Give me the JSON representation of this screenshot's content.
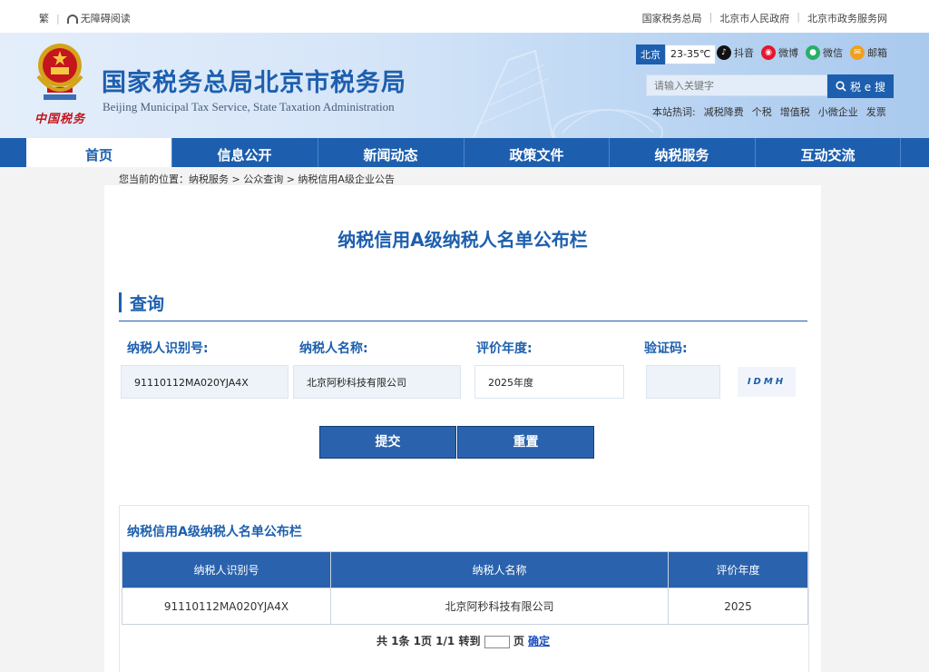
{
  "topbar": {
    "traditional": "繁",
    "accessible": "无障碍阅读",
    "links": [
      "国家税务总局",
      "北京市人民政府",
      "北京市政务服务网"
    ]
  },
  "header": {
    "emblem_text": "中国税务",
    "title": "国家税务总局北京市税务局",
    "subtitle": "Beijing Municipal Tax Service, State Taxation Administration",
    "weather": {
      "city": "北京",
      "temp": "23-35℃"
    },
    "social": [
      {
        "label": "抖音",
        "icon": "douyin-icon",
        "color": "#111111"
      },
      {
        "label": "微博",
        "icon": "weibo-icon",
        "color": "#e6162d"
      },
      {
        "label": "微信",
        "icon": "wechat-icon",
        "color": "#2aae67"
      },
      {
        "label": "邮箱",
        "icon": "mail-icon",
        "color": "#f0a020"
      }
    ],
    "search": {
      "placeholder": "请输入关键字",
      "button": "税 e 搜"
    },
    "hot": {
      "label": "本站热词:",
      "words": [
        "减税降费",
        "个税",
        "增值税",
        "小微企业",
        "发票"
      ]
    }
  },
  "nav": [
    "首页",
    "信息公开",
    "新闻动态",
    "政策文件",
    "纳税服务",
    "互动交流"
  ],
  "breadcrumb": "您当前的位置：纳税服务 > 公众查询 > 纳税信用A级企业公告",
  "page": {
    "title": "纳税信用A级纳税人名单公布栏",
    "section": "查询",
    "fields": {
      "tax_id": {
        "label": "纳税人识别号:",
        "value": "91110112MA020YJA4X"
      },
      "name": {
        "label": "纳税人名称:",
        "value": "北京阿秒科技有限公司"
      },
      "year": {
        "label": "评价年度:",
        "value": "2025年度"
      },
      "captcha": {
        "label": "验证码:",
        "value": "",
        "image_text": "IDMH"
      }
    },
    "submit": "提交",
    "reset": "重置"
  },
  "result": {
    "title": "纳税信用A级纳税人名单公布栏",
    "headers": [
      "纳税人识别号",
      "纳税人名称",
      "评价年度"
    ],
    "rows": [
      [
        "91110112MA020YJA4X",
        "北京阿秒科技有限公司",
        "2025"
      ]
    ],
    "pager": {
      "prefix": "共 1条 1页 1/1 转到",
      "suffix": "页",
      "confirm": "确定"
    }
  },
  "colors": {
    "brand": "#1d5fae",
    "button": "#2a62ad",
    "emblem_red": "#c4161c"
  }
}
